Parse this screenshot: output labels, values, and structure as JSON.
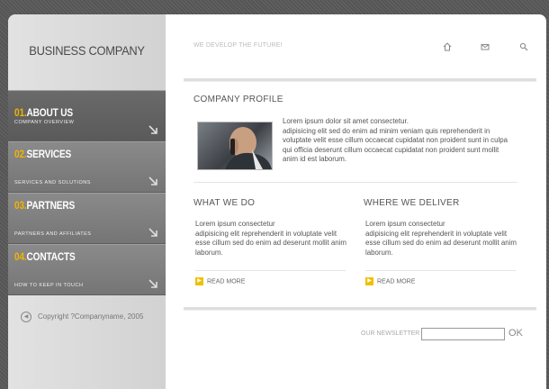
{
  "brand": {
    "name": "BUSINESS COMPANY"
  },
  "header": {
    "tagline": "WE DEVELOP THE FUTURE!",
    "icons": [
      "home-icon",
      "mail-icon",
      "search-icon"
    ]
  },
  "nav": {
    "items": [
      {
        "num": "01.",
        "label": "ABOUT US",
        "sub": "COMPANY OVERVIEW"
      },
      {
        "num": "02.",
        "label": "SERVICES",
        "sub": "SERVICES AND SOLUTIONS"
      },
      {
        "num": "03.",
        "label": "PARTNERS",
        "sub": "PARTNERS AND AFFILIATES"
      },
      {
        "num": "04.",
        "label": "CONTACTS",
        "sub": "HOW TO KEEP IN TOUCH"
      }
    ]
  },
  "footer": {
    "copyright": "Copyright ?Companyname, 2005"
  },
  "profile": {
    "title": "COMPANY PROFILE",
    "lead": "Lorem ipsum dolor sit amet consectetur.",
    "text": "adipisicing elit sed do enim ad minim veniam quis  reprehenderit in voluptate velit esse cillum occaecat cupidatat non proident sunt in culpa qui officia deserunt cillum occaecat cupidatat non proident sunt mollit anim id est laborum."
  },
  "what_we_do": {
    "title": "WHAT WE DO",
    "lead": "Lorem ipsum consectetur",
    "text": "adipisicing elit reprehenderit in voluptate velit esse cillum sed do enim ad deserunt mollit anim laborum.",
    "read_more": "READ MORE"
  },
  "where_we_deliver": {
    "title": "WHERE WE DELIVER",
    "lead": "Lorem ipsum consectetur",
    "text": "adipisicing elit reprehenderit in voluptate velit esse cillum sed do enim ad deserunt mollit anim laborum.",
    "read_more": "READ MORE"
  },
  "newsletter": {
    "label": "OUR NEWSLETTER",
    "value": "",
    "button": "OK"
  },
  "colors": {
    "accent": "#e89a00",
    "nav_bg": "#7a7a7a",
    "nav_number": "#f0b400"
  }
}
